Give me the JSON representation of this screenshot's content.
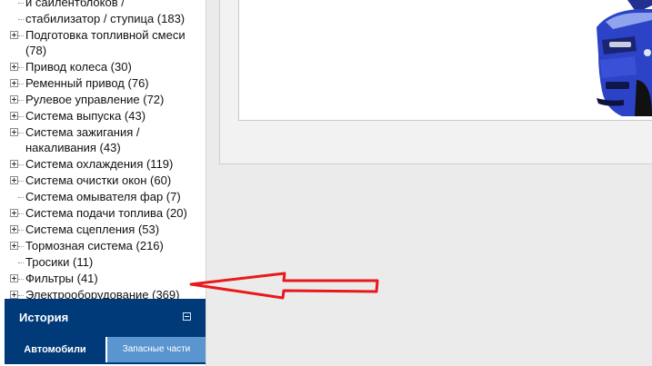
{
  "catalog_tree": {
    "items": [
      {
        "label": "и сайлентблоков /",
        "expandable": false
      },
      {
        "label": "стабилизатор / ступица (183)",
        "expandable": false
      },
      {
        "label": "Подготовка топливной смеси (78)",
        "expandable": true
      },
      {
        "label": "Привод колеса (30)",
        "expandable": true
      },
      {
        "label": "Ременный привод (76)",
        "expandable": true
      },
      {
        "label": "Рулевое управление (72)",
        "expandable": true
      },
      {
        "label": "Система выпуска (43)",
        "expandable": true
      },
      {
        "label": "Система зажигания / накаливания (43)",
        "expandable": true
      },
      {
        "label": "Система охлаждения (119)",
        "expandable": true
      },
      {
        "label": "Система очистки окон (60)",
        "expandable": true
      },
      {
        "label": "Система омывателя фар (7)",
        "expandable": false
      },
      {
        "label": "Система подачи топлива (20)",
        "expandable": true
      },
      {
        "label": "Система сцепления (53)",
        "expandable": true
      },
      {
        "label": "Тормозная система (216)",
        "expandable": true
      },
      {
        "label": "Тросики (11)",
        "expandable": false
      },
      {
        "label": "Фильтры (41)",
        "expandable": true
      },
      {
        "label": "Электрооборудование (369)",
        "expandable": true
      }
    ]
  },
  "history": {
    "title": "История",
    "tabs": {
      "cars": "Автомобили",
      "parts": "Запасные части"
    }
  },
  "colors": {
    "panel_header": "#003a78",
    "tab_inactive": "#5b95cf",
    "annotation_arrow": "#e8191c",
    "car_body": "#2c43c8"
  },
  "icons": {
    "expander": "plus-box-icon",
    "collapse": "minus-box-icon",
    "annotation": "red-arrow"
  }
}
